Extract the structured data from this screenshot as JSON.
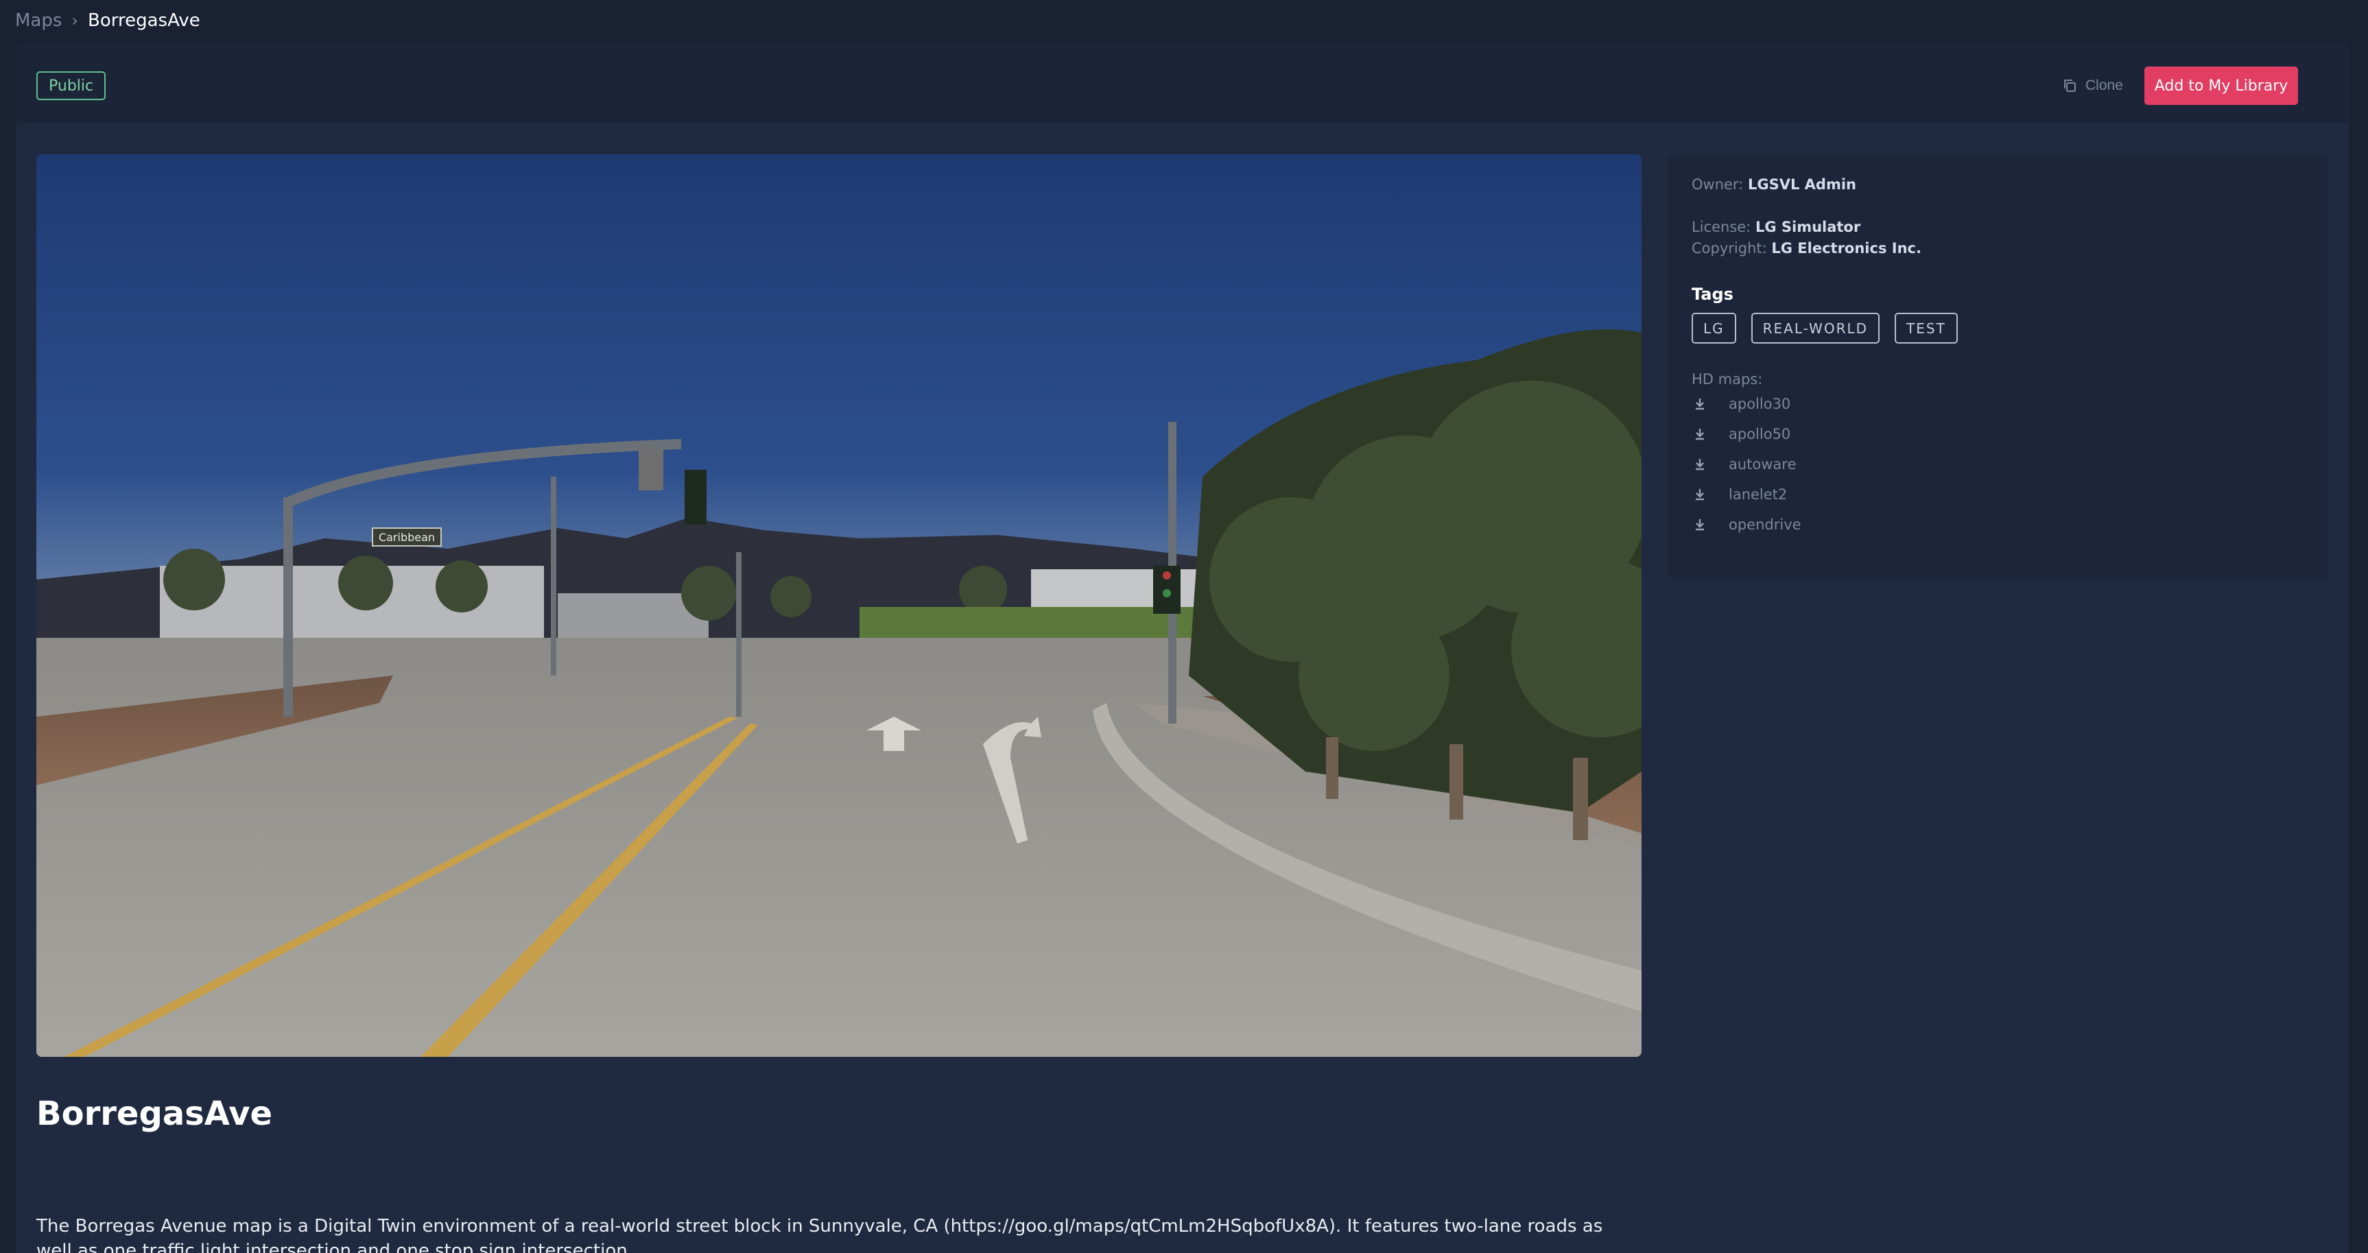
{
  "breadcrumb": {
    "parent": "Maps",
    "separator": "›",
    "current": "BorregasAve"
  },
  "visibility_badge": "Public",
  "actions": {
    "clone_label": "Clone",
    "library_label": "Add to My Library"
  },
  "hero_image": {
    "description_icon": "map-preview-image",
    "street_sign": "Caribbean"
  },
  "info": {
    "owner_label": "Owner:",
    "owner_value": "LGSVL Admin",
    "license_label": "License:",
    "license_value": "LG Simulator",
    "copyright_label": "Copyright:",
    "copyright_value": "LG Electronics Inc."
  },
  "tags_title": "Tags",
  "tags": [
    "LG",
    "REAL-WORLD",
    "TEST"
  ],
  "hdmaps_title": "HD maps:",
  "hdmaps": [
    "apollo30",
    "apollo50",
    "autoware",
    "lanelet2",
    "opendrive"
  ],
  "map_title": "BorregasAve",
  "map_description": "The Borregas Avenue map is a Digital Twin environment of a real-world street block in Sunnyvale, CA (https://goo.gl/maps/qtCmLm2HSqbofUx8A). It features two-lane roads as well as one traffic light intersection and one stop sign intersection.",
  "colors": {
    "accent": "#e23d63",
    "badge_green": "#7fd3a6",
    "background": "#1a2133",
    "panel": "#1f2a40"
  }
}
